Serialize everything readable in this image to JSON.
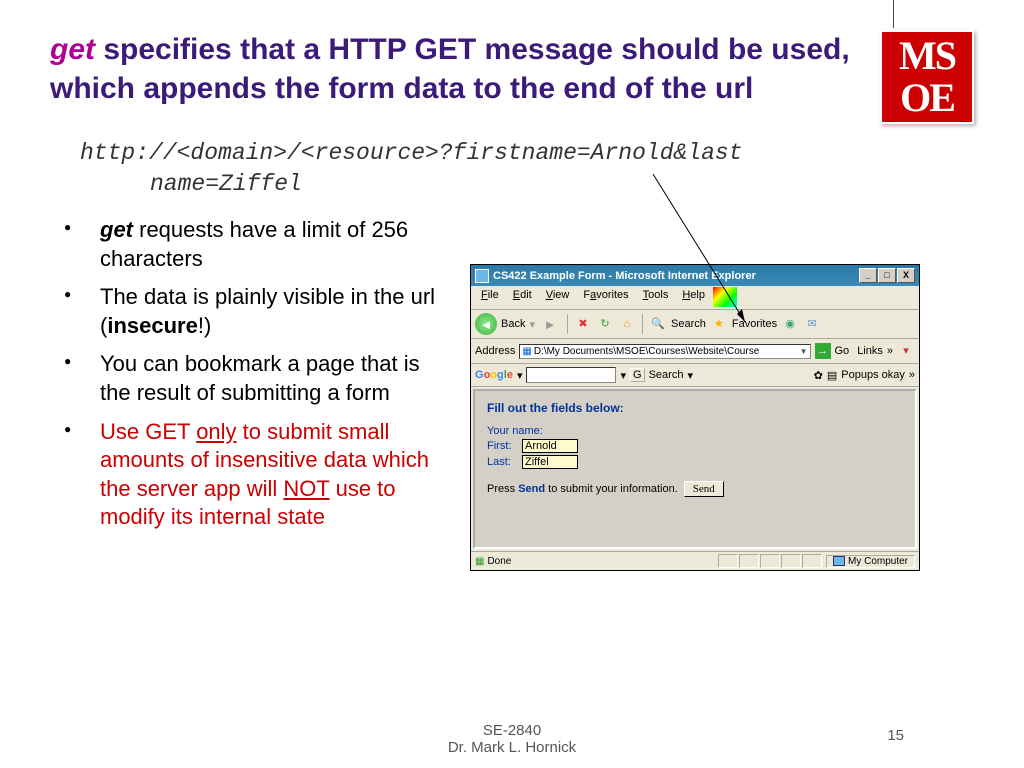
{
  "title": {
    "get_word": "get",
    "rest": " specifies that a HTTP GET message should be used, which appends the form data to the end of the url"
  },
  "logo": {
    "line1": "MS",
    "line2": "OE"
  },
  "url_example": {
    "line1": "http://<domain>/<resource>?firstname=Arnold&last",
    "line2": "name=Ziffel"
  },
  "bullets": {
    "b1_get": "get",
    "b1_rest": " requests have a limit of 256 characters",
    "b2_a": "The data is plainly visible in the url (",
    "b2_b": "insecure",
    "b2_c": "!)",
    "b3": "You can bookmark a page that is the result of submitting a form",
    "b4_a": "Use GET ",
    "b4_only": "only",
    "b4_b": " to submit small amounts of insensitive data which the server app will ",
    "b4_not": "NOT",
    "b4_c": " use to modify its internal state"
  },
  "ie": {
    "title": "CS422 Example Form - Microsoft Internet Explorer",
    "menu": {
      "file": "File",
      "edit": "Edit",
      "view": "View",
      "favorites": "Favorites",
      "tools": "Tools",
      "help": "Help"
    },
    "toolbar": {
      "back": "Back",
      "search": "Search",
      "favorites": "Favorites"
    },
    "address_label": "Address",
    "address_value": "D:\\My Documents\\MSOE\\Courses\\Website\\Course",
    "go": "Go",
    "links": "Links",
    "google": {
      "label": "Google",
      "search": "Search",
      "popups": "Popups okay"
    },
    "form": {
      "heading": "Fill out the fields below:",
      "your_name": "Your name:",
      "first_label": "First:",
      "first_value": "Arnold",
      "last_label": "Last:",
      "last_value": "Ziffel",
      "press_a": "Press ",
      "press_send": "Send",
      "press_b": " to submit your information.",
      "send_btn": "Send"
    },
    "status": {
      "done": "Done",
      "zone": "My Computer"
    }
  },
  "footer": {
    "course": "SE-2840",
    "author": "Dr. Mark L. Hornick",
    "page": "15"
  }
}
